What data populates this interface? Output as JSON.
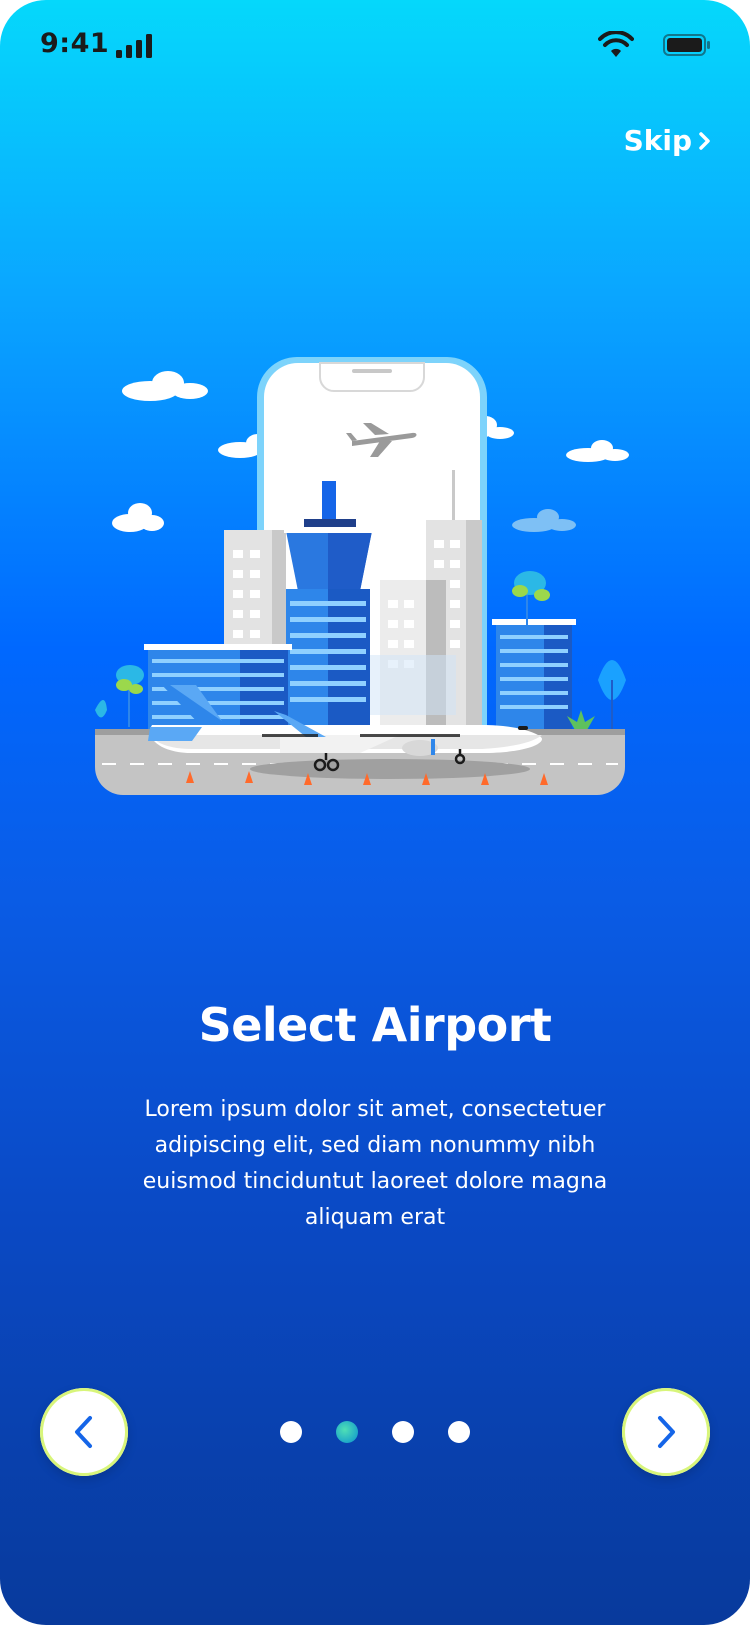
{
  "status_bar": {
    "time": "9:41"
  },
  "header": {
    "skip_label": "Skip"
  },
  "onboarding": {
    "title": "Select Airport",
    "description": "Lorem ipsum dolor sit amet, consectetuer adipiscing elit, sed diam nonummy nibh euismod tinciduntut laoreet dolore magna aliquam erat",
    "current_step": 2,
    "total_steps": 4
  },
  "icons": {
    "prev": "chevron-left-icon",
    "next": "chevron-right-icon",
    "skip": "chevron-right-icon",
    "signal": "cellular-signal-icon",
    "wifi": "wifi-icon",
    "battery": "battery-icon"
  },
  "colors": {
    "background_top": "#05d8fb",
    "background_bottom": "#083a9c",
    "accent_blue": "#1565e8",
    "dot_active": "#2bc3b8",
    "button_ring": "#d8f57a"
  }
}
